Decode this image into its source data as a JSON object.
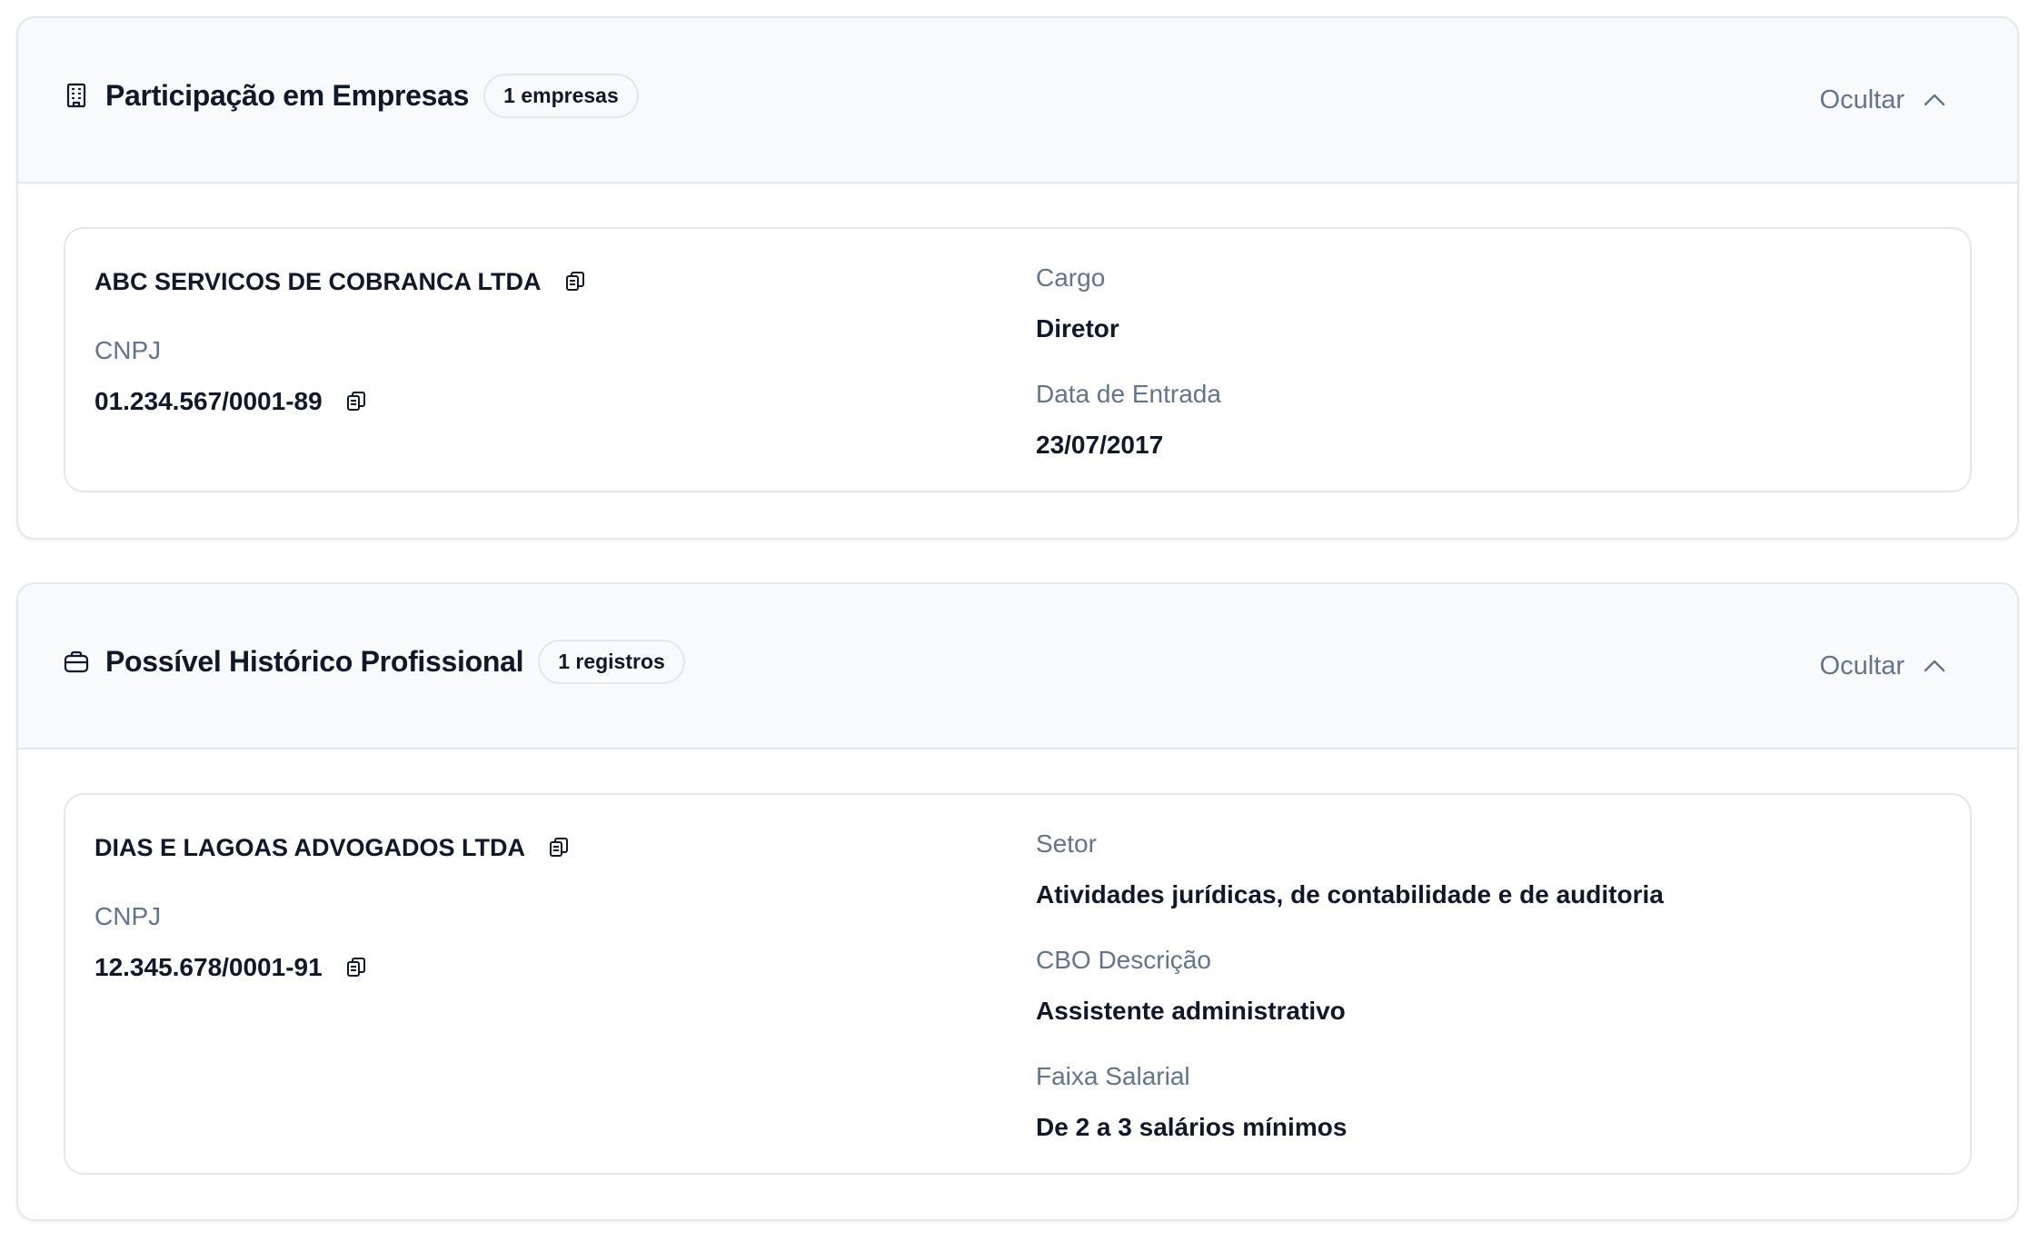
{
  "sections": [
    {
      "icon": "building-icon",
      "title": "Participação em Empresas",
      "badge": "1 empresas",
      "toggle_label": "Ocultar",
      "card": {
        "company_name": "ABC SERVICOS DE COBRANCA LTDA",
        "cnpj_label": "CNPJ",
        "cnpj_value": "01.234.567/0001-89",
        "fields": [
          {
            "label": "Cargo",
            "value": "Diretor"
          },
          {
            "label": "Data de Entrada",
            "value": "23/07/2017"
          }
        ]
      }
    },
    {
      "icon": "briefcase-icon",
      "title": "Possível Histórico Profissional",
      "badge": "1 registros",
      "toggle_label": "Ocultar",
      "card": {
        "company_name": "DIAS E LAGOAS ADVOGADOS LTDA",
        "cnpj_label": "CNPJ",
        "cnpj_value": "12.345.678/0001-91",
        "fields": [
          {
            "label": "Setor",
            "value": "Atividades jurídicas, de contabilidade e de auditoria"
          },
          {
            "label": "CBO Descrição",
            "value": "Assistente administrativo"
          },
          {
            "label": "Faixa Salarial",
            "value": "De 2 a 3 salários mínimos"
          }
        ]
      }
    }
  ]
}
